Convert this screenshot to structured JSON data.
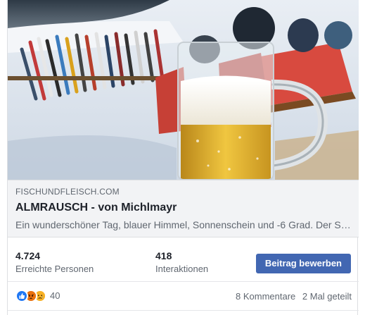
{
  "link_preview": {
    "domain": "FISCHUNDFLEISCH.COM",
    "title": "ALMRAUSCH - von Michlmayr",
    "description": "Ein wunderschöner Tag, blauer Himmel, Sonnenschein und -6 Grad. Der Skitag kann beginnen."
  },
  "stats": {
    "reach_value": "4.724",
    "reach_label": "Erreichte Personen",
    "engagement_value": "418",
    "engagement_label": "Interaktionen"
  },
  "promote_button_label": "Beitrag bewerben",
  "reactions": {
    "icons": [
      "like-icon",
      "angry-icon",
      "sad-icon"
    ],
    "count": "40"
  },
  "counts": {
    "comments": "8 Kommentare",
    "shares": "2 Mal geteilt"
  },
  "colors": {
    "accent": "#4267b2",
    "like": "#2078f4",
    "angry": "#e9710f",
    "sad": "#f7b125"
  }
}
